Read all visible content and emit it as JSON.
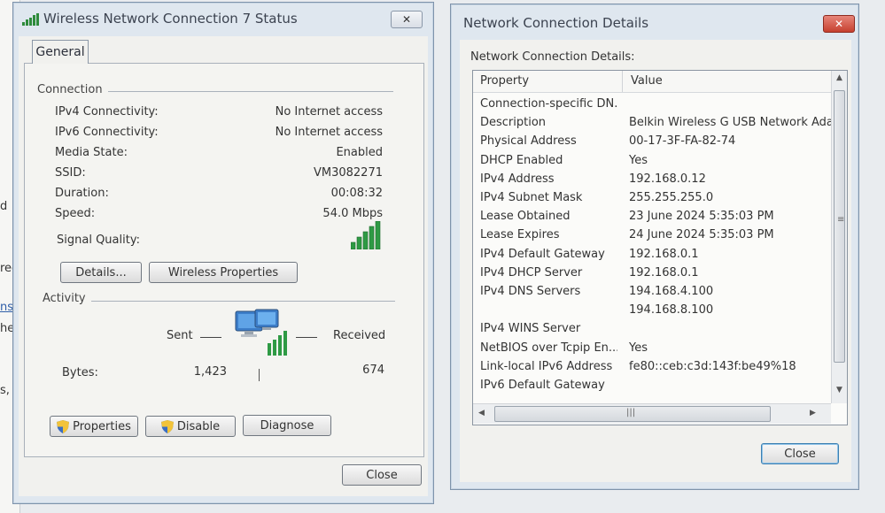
{
  "background": {
    "fragments": [
      "d",
      "red",
      "ns",
      "her",
      "s, o"
    ]
  },
  "status_window": {
    "title": "Wireless Network Connection 7 Status",
    "close_glyph": "✕",
    "tab": "General",
    "connection": {
      "label": "Connection",
      "rows": [
        {
          "key": "IPv4 Connectivity:",
          "value": "No Internet access"
        },
        {
          "key": "IPv6 Connectivity:",
          "value": "No Internet access"
        },
        {
          "key": "Media State:",
          "value": "Enabled"
        },
        {
          "key": "SSID:",
          "value": "VM3082271"
        },
        {
          "key": "Duration:",
          "value": "00:08:32"
        },
        {
          "key": "Speed:",
          "value": "54.0 Mbps"
        }
      ],
      "signal_label": "Signal Quality:",
      "signal_bars_filled": 5,
      "details_button": "Details...",
      "wireless_properties_button": "Wireless Properties"
    },
    "activity": {
      "label": "Activity",
      "sent_label": "Sent",
      "received_label": "Received",
      "bytes_label": "Bytes:",
      "bytes_sent": "1,423",
      "bytes_received": "674"
    },
    "buttons": {
      "properties": "Properties",
      "disable": "Disable",
      "diagnose": "Diagnose",
      "close": "Close"
    }
  },
  "details_window": {
    "title": "Network Connection Details",
    "close_glyph": "✕",
    "caption": "Network Connection Details:",
    "columns": {
      "property": "Property",
      "value": "Value"
    },
    "rows": [
      {
        "property": "Connection-specific DN...",
        "value": ""
      },
      {
        "property": "Description",
        "value": "Belkin Wireless G USB Network Adap"
      },
      {
        "property": "Physical Address",
        "value": "00-17-3F-FA-82-74"
      },
      {
        "property": "DHCP Enabled",
        "value": "Yes"
      },
      {
        "property": "IPv4 Address",
        "value": "192.168.0.12"
      },
      {
        "property": "IPv4 Subnet Mask",
        "value": "255.255.255.0"
      },
      {
        "property": "Lease Obtained",
        "value": "23 June 2024 5:35:03 PM"
      },
      {
        "property": "Lease Expires",
        "value": "24 June 2024 5:35:03 PM"
      },
      {
        "property": "IPv4 Default Gateway",
        "value": "192.168.0.1"
      },
      {
        "property": "IPv4 DHCP Server",
        "value": "192.168.0.1"
      },
      {
        "property": "IPv4 DNS Servers",
        "value": "194.168.4.100"
      },
      {
        "property": "",
        "value": "194.168.8.100"
      },
      {
        "property": "IPv4 WINS Server",
        "value": ""
      },
      {
        "property": "NetBIOS over Tcpip En...",
        "value": "Yes"
      },
      {
        "property": "Link-local IPv6 Address",
        "value": "fe80::ceb:c3d:143f:be49%18"
      },
      {
        "property": "IPv6 Default Gateway",
        "value": ""
      }
    ],
    "close_button": "Close"
  }
}
